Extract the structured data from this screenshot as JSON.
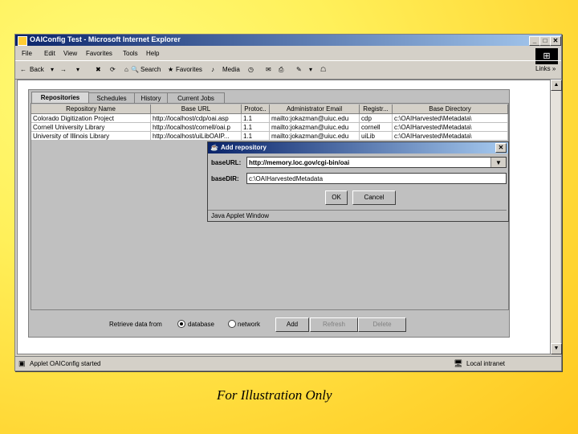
{
  "window": {
    "title": "OAIConfig Test - Microsoft Internet Explorer",
    "minimize": "_",
    "maximize": "□",
    "close": "✕"
  },
  "menu": [
    "File",
    "Edit",
    "View",
    "Favorites",
    "Tools",
    "Help"
  ],
  "toolbar": {
    "back": "Back",
    "search": "Search",
    "favorites": "Favorites",
    "media": "Media",
    "links": "Links"
  },
  "applet": {
    "tabs": [
      "Repositories",
      "Schedules",
      "History",
      "Current Jobs"
    ],
    "selected_tab": 0,
    "columns": [
      "Repository Name",
      "Base URL",
      "Protoc..",
      "Administrator Email",
      "Registr...",
      "Base Directory"
    ],
    "rows": [
      [
        "Colorado Digitization Project",
        "http://localhost/cdp/oai.asp",
        "1.1",
        "mailto:jokazman@uiuc.edu",
        "cdp",
        "c:\\OAIHarvested\\Metadata\\"
      ],
      [
        "Cornell University Library",
        "http://localhost/cornell/oai.p",
        "1.1",
        "mailto:jokazman@uiuc.edu",
        "cornell",
        "c:\\OAIHarvested\\Metadata\\"
      ],
      [
        "University of Illinois Library",
        "http://localhost/uiLibOAIP...",
        "1.1",
        "mailto:jokazman@uiuc.edu",
        "uiLib",
        "c:\\OAIHarvested\\Metadata\\"
      ]
    ],
    "retrieve_label": "Retrieve data from",
    "option_database": "database",
    "option_network": "network",
    "selected_option": "database",
    "add": "Add",
    "refresh": "Refresh",
    "delete": "Delete"
  },
  "dialog": {
    "title": "Add repository",
    "base_url_label": "baseURL:",
    "base_url_value": "http://memory.loc.gov/cgi-bin/oai",
    "base_dir_label": "baseDIR:",
    "base_dir_value": "c:\\OAIHarvestedMetadata",
    "ok": "OK",
    "cancel": "Cancel",
    "footer": "Java Applet Window",
    "close": "✕"
  },
  "status": {
    "message": "Applet OAIConfig started",
    "zone": "Local intranet"
  },
  "caption": "For Illustration Only"
}
